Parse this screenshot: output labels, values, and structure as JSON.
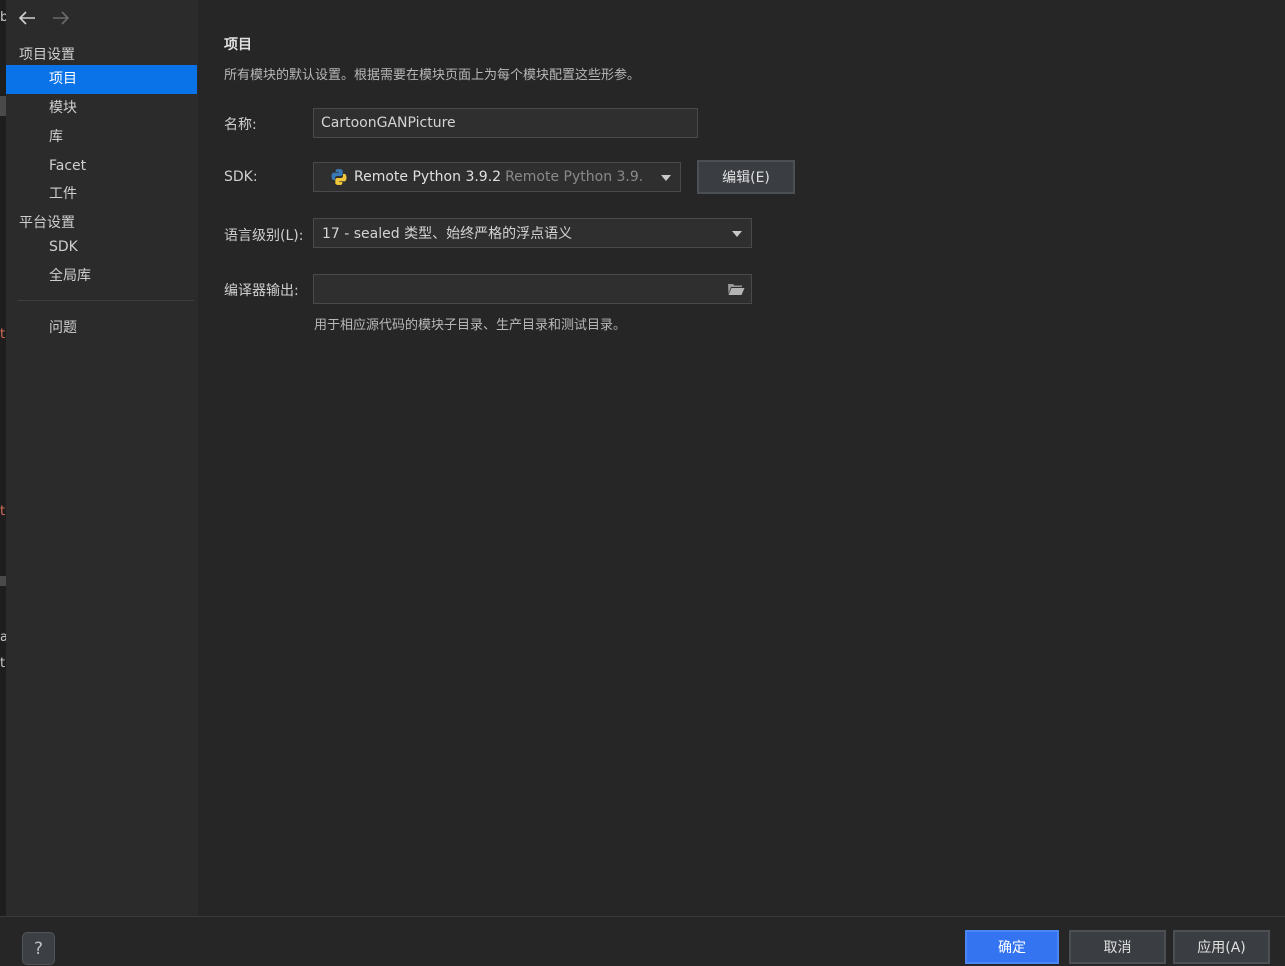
{
  "edge_fragments": [
    "b",
    "ti",
    "ti",
    "a",
    "t"
  ],
  "sidebar": {
    "sections": [
      {
        "label": "项目设置",
        "items": [
          {
            "label": "项目",
            "selected": true
          },
          {
            "label": "模块"
          },
          {
            "label": "库"
          },
          {
            "label": "Facet"
          },
          {
            "label": "工件"
          }
        ]
      },
      {
        "label": "平台设置",
        "items": [
          {
            "label": "SDK"
          },
          {
            "label": "全局库"
          }
        ]
      }
    ],
    "problems": "问题"
  },
  "main": {
    "title": "项目",
    "description": "所有模块的默认设置。根据需要在模块页面上为每个模块配置这些形参。",
    "name": {
      "label": "名称:",
      "value": "CartoonGANPicture"
    },
    "sdk": {
      "label": "SDK:",
      "value": "Remote Python 3.9.2",
      "detail": "Remote Python 3.9.",
      "icon": "python-icon",
      "edit_button": "编辑(E)"
    },
    "language_level": {
      "label": "语言级别(L):",
      "value": "17 - sealed 类型、始终严格的浮点语义"
    },
    "compiler_output": {
      "label": "编译器输出:",
      "value": "",
      "icon": "folder-icon"
    },
    "compiler_hint": "用于相应源代码的模块子目录、生产目录和测试目录。"
  },
  "footer": {
    "help": "?",
    "ok": "确定",
    "cancel": "取消",
    "apply": "应用(A)"
  },
  "colors": {
    "accent": "#3574f0",
    "selection": "#0a73e8"
  }
}
